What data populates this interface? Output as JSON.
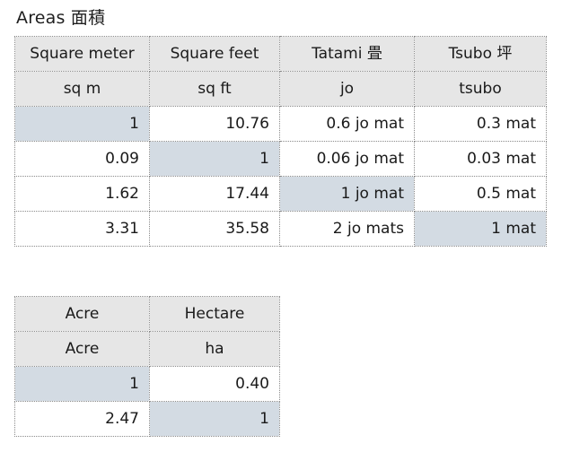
{
  "page": {
    "title": "Areas 面積"
  },
  "colors": {
    "header_bg": "#e6e6e6",
    "highlight_bg": "#d3dbe3",
    "border": "#8a8a8a",
    "text": "#1a1a1a",
    "page_bg": "#ffffff"
  },
  "tables": [
    {
      "id": "areas-table",
      "headers": [
        "Square meter",
        "Square feet",
        "Tatami 畳",
        "Tsubo 坪"
      ],
      "units": [
        "sq m",
        "sq ft",
        "jo",
        "tsubo"
      ],
      "rows": [
        {
          "cells": [
            "1",
            "10.76",
            "0.6 jo mat",
            "0.3 mat"
          ],
          "highlight": [
            true,
            false,
            false,
            false
          ]
        },
        {
          "cells": [
            "0.09",
            "1",
            "0.06 jo mat",
            "0.03 mat"
          ],
          "highlight": [
            false,
            true,
            false,
            false
          ]
        },
        {
          "cells": [
            "1.62",
            "17.44",
            "1 jo mat",
            "0.5 mat"
          ],
          "highlight": [
            false,
            false,
            true,
            false
          ]
        },
        {
          "cells": [
            "3.31",
            "35.58",
            "2 jo mats",
            "1 mat"
          ],
          "highlight": [
            false,
            false,
            false,
            true
          ]
        }
      ]
    },
    {
      "id": "acre-table",
      "headers": [
        "Acre",
        "Hectare"
      ],
      "units": [
        "Acre",
        "ha"
      ],
      "rows": [
        {
          "cells": [
            "1",
            "0.40"
          ],
          "highlight": [
            true,
            false
          ]
        },
        {
          "cells": [
            "2.47",
            "1"
          ],
          "highlight": [
            false,
            true
          ]
        }
      ]
    }
  ]
}
